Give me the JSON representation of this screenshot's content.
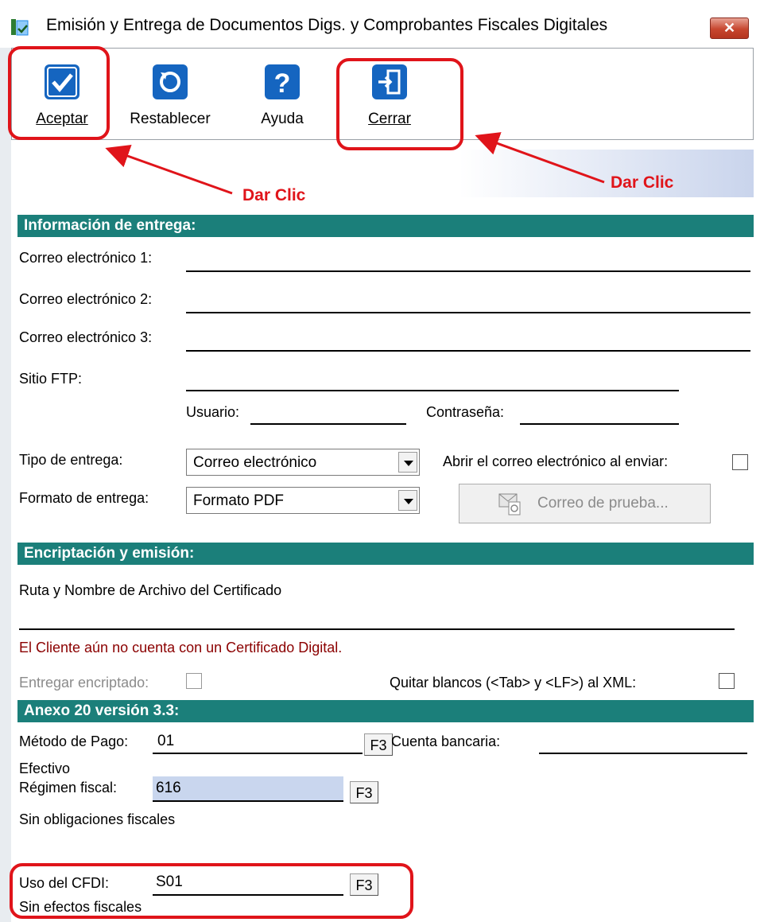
{
  "window": {
    "title": "Emisión y Entrega de Documentos Digs. y Comprobantes Fiscales Digitales",
    "close_label": "✕"
  },
  "toolbar": {
    "buttons": [
      {
        "label": "Aceptar",
        "icon": "check-icon"
      },
      {
        "label": "Restablecer",
        "icon": "refresh-icon"
      },
      {
        "label": "Ayuda",
        "icon": "help-icon"
      },
      {
        "label": "Cerrar",
        "icon": "exit-door-icon"
      }
    ]
  },
  "annotations": {
    "left": "Dar Clic",
    "right": "Dar Clic"
  },
  "delivery": {
    "section_title": "Información de entrega:",
    "email1_label": "Correo electrónico 1:",
    "email1_value": "",
    "email2_label": "Correo electrónico 2:",
    "email2_value": "",
    "email3_label": "Correo electrónico 3:",
    "email3_value": "",
    "ftp_label": "Sitio FTP:",
    "ftp_value": "",
    "user_label": "Usuario:",
    "user_value": "",
    "password_label": "Contraseña:",
    "password_value": "",
    "delivery_type_label": "Tipo de entrega:",
    "delivery_type_value": "Correo electrónico",
    "open_email_label": "Abrir el correo electrónico al enviar:",
    "open_email_checked": false,
    "format_label": "Formato de entrega:",
    "format_value": "Formato PDF",
    "test_email_label": "Correo de prueba..."
  },
  "encryption": {
    "section_title": "Encriptación y emisión:",
    "cert_path_label": "Ruta y Nombre de Archivo del Certificado",
    "cert_path_value": "",
    "warning": "El Cliente aún no cuenta con un Certificado Digital.",
    "encrypted_label": "Entregar encriptado:",
    "strip_blanks_label": "Quitar blancos (<Tab> y <LF>) al  XML:",
    "warning_color": "#8b0000"
  },
  "anexo": {
    "section_title": "Anexo 20 versión 3.3:",
    "payment_method_label": "Método de Pago:",
    "payment_method_value": "01",
    "payment_method_desc": "Efectivo",
    "f3_label": "F3",
    "bank_account_label": "Cuenta bancaria:",
    "bank_account_value": "",
    "regime_label": "Régimen fiscal:",
    "regime_value": "616",
    "regime_desc": "Sin obligaciones fiscales",
    "cfdi_label": "Uso del CFDI:",
    "cfdi_value": "S01",
    "cfdi_desc": "Sin efectos fiscales"
  },
  "colors": {
    "section_bg": "#1b7f7a",
    "highlight": "#e0141a",
    "toolbar_icon": "#1565c0"
  }
}
